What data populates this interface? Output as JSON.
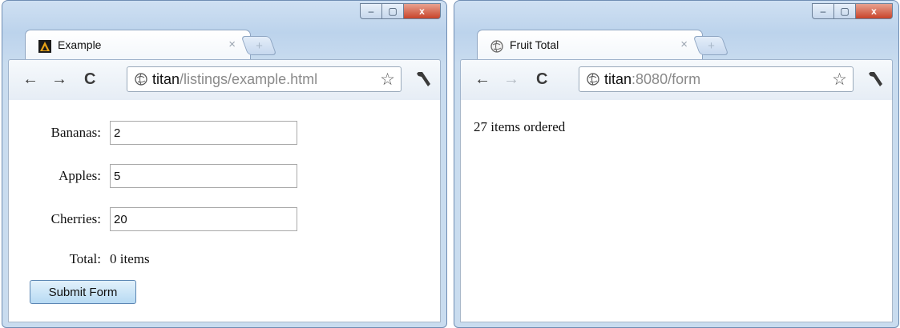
{
  "left_window": {
    "tab_title": "Example",
    "url_host": "titan",
    "url_path": "/listings/example.html",
    "form": {
      "fields": [
        {
          "label": "Bananas:",
          "value": "2"
        },
        {
          "label": "Apples:",
          "value": "5"
        },
        {
          "label": "Cherries:",
          "value": "20"
        }
      ],
      "total_label": "Total:",
      "total_value": "0 items",
      "submit_label": "Submit Form"
    }
  },
  "right_window": {
    "tab_title": "Fruit Total",
    "url_host": "titan",
    "url_path": ":8080/form",
    "message": "27 items ordered"
  },
  "icons": {
    "tab_close": "×",
    "new_tab": "+",
    "back": "←",
    "forward": "→",
    "reload": "C",
    "bookmark_star": "☆",
    "window_minimize": "–",
    "window_maximize": "▢",
    "window_close": "x"
  },
  "colors": {
    "close_button": "#c8442b",
    "submit_button": "#b7daf3",
    "frame": "#c9dcef"
  }
}
